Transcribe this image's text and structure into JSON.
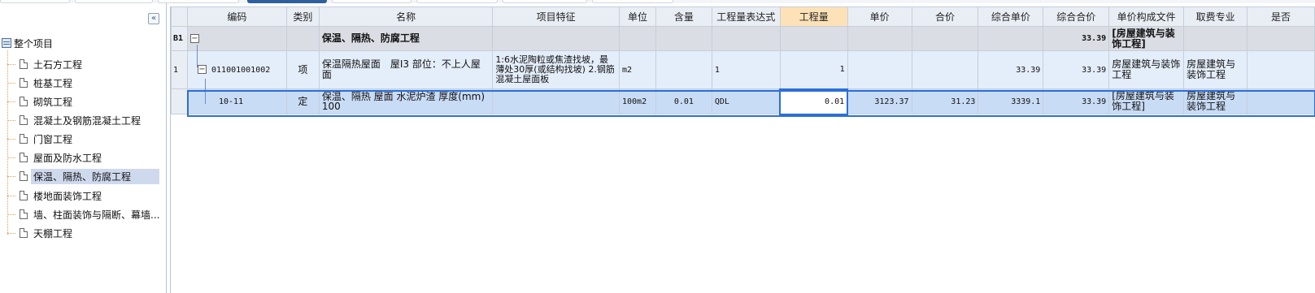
{
  "sidebar": {
    "collapse_glyph": "«",
    "root_label": "整个项目",
    "items": [
      {
        "label": "土石方工程"
      },
      {
        "label": "桩基工程"
      },
      {
        "label": "砌筑工程"
      },
      {
        "label": "混凝土及钢筋混凝土工程"
      },
      {
        "label": "门窗工程"
      },
      {
        "label": "屋面及防水工程"
      },
      {
        "label": "保温、隔热、防腐工程",
        "selected": true
      },
      {
        "label": "楼地面装饰工程"
      },
      {
        "label": "墙、柱面装饰与隔断、幕墙..."
      },
      {
        "label": "天棚工程"
      }
    ]
  },
  "grid": {
    "headers": [
      "编码",
      "类别",
      "名称",
      "项目特征",
      "单位",
      "含量",
      "工程量表达式",
      "工程量",
      "单价",
      "合价",
      "综合单价",
      "综合合价",
      "单价构成文件",
      "取费专业",
      "是否"
    ],
    "highlight_header": "工程量",
    "rows": [
      {
        "rowhead": "B1",
        "toggle": "−",
        "code": "",
        "type": "",
        "name": "保温、隔热、防腐工程",
        "feature": "",
        "unit": "",
        "content": "",
        "expr": "",
        "qty": "",
        "price": "",
        "total": "",
        "unit_total": "",
        "sum_total": "33.39",
        "composition": "[房屋建筑与装饰工程]",
        "fee": "",
        "flag": ""
      },
      {
        "rowhead": "1",
        "toggle": "−",
        "code": "011001001002",
        "type": "项",
        "name": "保温隔热屋面　屋I3 部位：不上人屋面",
        "feature": "1:6水泥陶粒或焦渣找坡，最薄处30厚(或结构找坡) 2.钢筋混凝土屋面板",
        "unit": "m2",
        "content": "",
        "expr": "1",
        "qty": "1",
        "price": "",
        "total": "",
        "unit_total": "33.39",
        "sum_total": "33.39",
        "composition": "房屋建筑与装饰工程",
        "fee": "房屋建筑与装饰工程",
        "flag": ""
      },
      {
        "rowhead": "",
        "toggle": "",
        "code": "10-11",
        "type": "定",
        "name": "保温、隔热 屋面 水泥炉渣 厚度(mm) 100",
        "feature": "",
        "unit": "100m2",
        "content": "0.01",
        "expr": "QDL",
        "qty": "0.01",
        "price": "3123.37",
        "total": "31.23",
        "unit_total": "3339.1",
        "sum_total": "33.39",
        "composition": "[房屋建筑与装饰工程]",
        "fee": "房屋建筑与装饰工程",
        "flag": ""
      }
    ]
  }
}
